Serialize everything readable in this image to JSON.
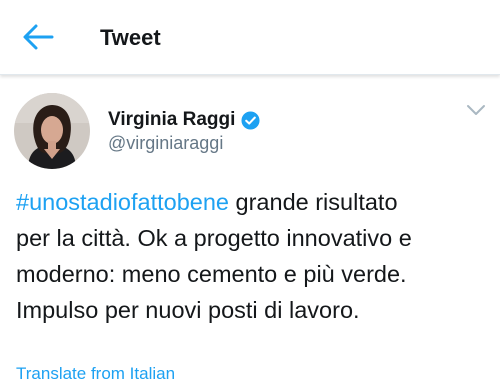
{
  "header": {
    "title": "Tweet",
    "back_icon": "arrow-left-icon",
    "accent": "#1da1f2"
  },
  "tweet": {
    "author_name": "Virginia Raggi",
    "author_handle": "@virginiaraggi",
    "verified_icon": "verified-badge-icon",
    "menu_icon": "chevron-down-icon",
    "hashtag": "#unostadiofattobene",
    "text_line1_rest": " grande risultato",
    "text_line2": "per la città. Ok a progetto innovativo e",
    "text_line3": "moderno: meno cemento e più verde.",
    "text_line4": "Impulso per nuovi posti di lavoro.",
    "translate_label": "Translate from Italian"
  }
}
